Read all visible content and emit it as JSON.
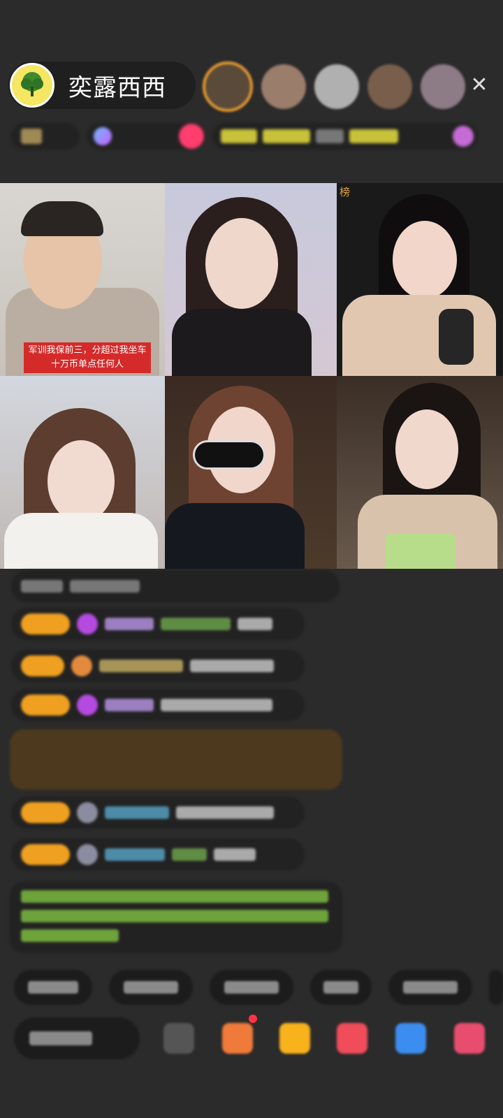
{
  "header": {
    "host_name": "奕露西西",
    "close_icon_glyph": "✕"
  },
  "grid": {
    "tile1_banner": "军训我保前三，分超过我坐车十万币单点任何人",
    "tile3_badge": "榜"
  },
  "colors": {
    "background": "#2b2b2b",
    "accent_orange": "#f0a020",
    "banner_red": "#d52a2a",
    "green_text": "#6ea33c"
  }
}
